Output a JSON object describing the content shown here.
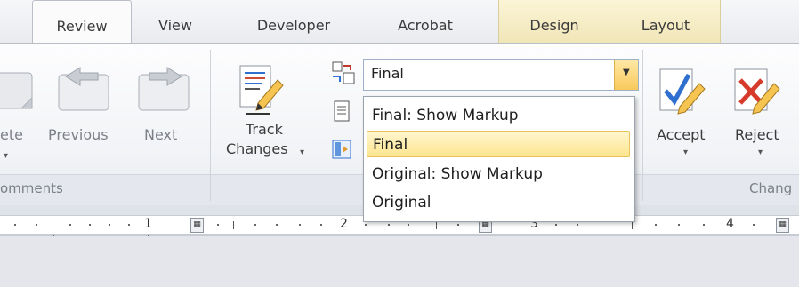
{
  "tabs": [
    {
      "label": "Review",
      "active": true
    },
    {
      "label": "View"
    },
    {
      "label": "Developer"
    },
    {
      "label": "Acrobat"
    },
    {
      "label": "Design"
    },
    {
      "label": "Layout"
    }
  ],
  "comments": {
    "delete_label": "ete",
    "previous_label": "Previous",
    "next_label": "Next",
    "group_label": "omments"
  },
  "tracking": {
    "track_changes_line1": "Track",
    "track_changes_line2": "Changes",
    "display_value": "Final",
    "display_options": [
      "Final: Show Markup",
      "Final",
      "Original: Show Markup",
      "Original"
    ],
    "selected_option": "Final"
  },
  "changes": {
    "accept_label": "Accept",
    "reject_label": "Reject",
    "group_label": "Chang"
  },
  "ruler": {
    "numbers": [
      "1",
      "2",
      "3",
      "4"
    ]
  },
  "colors": {
    "selected_highlight": "#fde58f",
    "context_tab_band": "#f1e6b8",
    "accept_check": "#2f6fd0",
    "reject_cross": "#d63a2a"
  }
}
